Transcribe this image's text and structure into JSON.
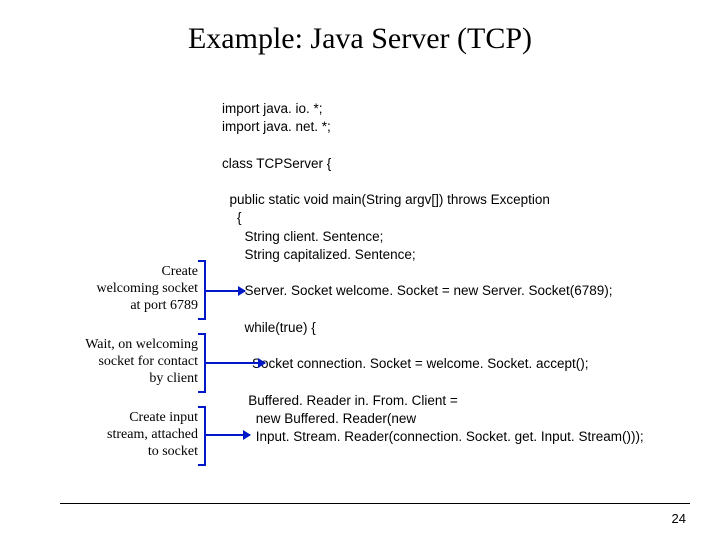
{
  "title": "Example: Java Server (TCP)",
  "code": {
    "l1": "import java. io. *;",
    "l2": "import java. net. *;",
    "l3": "",
    "l4": "class TCPServer {",
    "l5": "",
    "l6": "  public static void main(String argv[]) throws Exception",
    "l7": "    {",
    "l8": "      String client. Sentence;",
    "l9": "      String capitalized. Sentence;",
    "l10": "",
    "l11": "      Server. Socket welcome. Socket = new Server. Socket(6789);",
    "l12": "",
    "l13": "      while(true) {",
    "l14": "",
    "l15": "        Socket connection. Socket = welcome. Socket. accept();",
    "l16": "",
    "l17": "       Buffered. Reader in. From. Client =",
    "l18": "         new Buffered. Reader(new",
    "l19": "         Input. Stream. Reader(connection. Socket. get. Input. Stream()));"
  },
  "annotations": {
    "a1": {
      "l1": "Create",
      "l2": "welcoming socket",
      "l3": "at port 6789"
    },
    "a2": {
      "l1": "Wait, on welcoming",
      "l2": "socket for contact",
      "l3": "by client"
    },
    "a3": {
      "l1": "Create input",
      "l2": "stream, attached",
      "l3": "to socket"
    }
  },
  "page_number": "24"
}
